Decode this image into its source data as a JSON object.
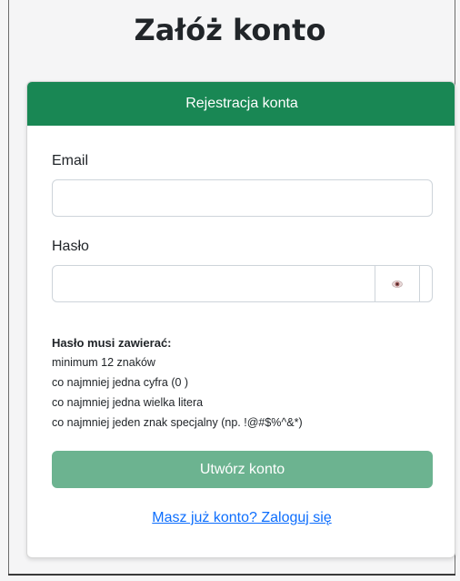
{
  "page": {
    "title": "Załóż konto"
  },
  "card": {
    "header": "Rejestracja konta",
    "email_label": "Email",
    "email_value": "",
    "email_placeholder": "",
    "password_label": "Hasło",
    "password_value": "",
    "password_placeholder": "",
    "toggle_icon": "eye-icon",
    "requirements": {
      "title": "Hasło musi zawierać:",
      "items": [
        "minimum 12 znaków",
        "co najmniej jedna cyfra (0 )",
        "co najmniej jedna wielka litera",
        "co najmniej jeden znak specjalny (np. !@#$%^&*)"
      ]
    },
    "submit_label": "Utwórz konto",
    "login_link": "Masz już konto? Zaloguj się"
  },
  "colors": {
    "header_bg": "#198754",
    "submit_bg": "#6cb390",
    "link": "#0d6efd"
  }
}
